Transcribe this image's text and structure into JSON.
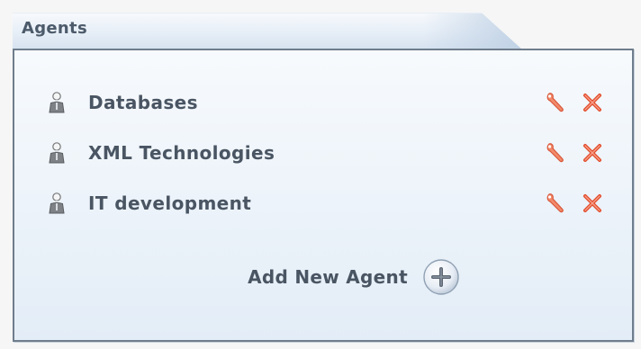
{
  "panel": {
    "title": "Agents"
  },
  "agents": [
    {
      "label": "Databases"
    },
    {
      "label": "XML Technologies"
    },
    {
      "label": "IT development"
    }
  ],
  "add_agent": {
    "label": "Add New Agent"
  },
  "icons": {
    "agent": "person-icon",
    "edit": "wrench-icon",
    "delete": "close-icon",
    "add": "plus-icon"
  },
  "colors": {
    "text": "#4a5563",
    "action_red": "#e24a2a",
    "border": "#6f7d8c",
    "panel_bg": "#eef4fa"
  }
}
